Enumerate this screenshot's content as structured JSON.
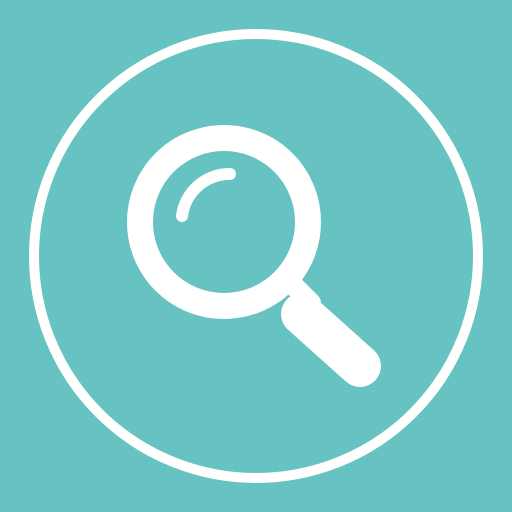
{
  "icon": {
    "name": "magnifying-glass-icon",
    "ring_name": "circle-outline",
    "background_color": "#66c3c2",
    "foreground_color": "#ffffff"
  }
}
